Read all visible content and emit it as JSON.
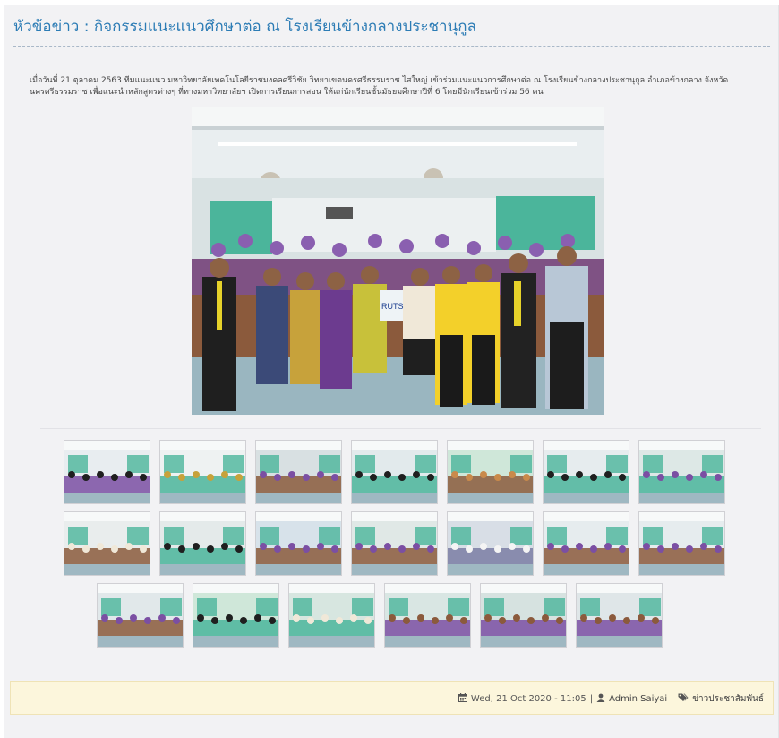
{
  "news": {
    "title": "หัวข้อข่าว : กิจกรรมแนะแนวศึกษาต่อ ณ โรงเรียนข้างกลางประชานุกูล",
    "body": "เมื่อวันที่ 21 ตุลาคม 2563 ทีมแนะแนว มหาวิทยาลัยเทคโนโลยีราชมงคลศรีวิชัย วิทยาเขตนครศรีธรรมราช ไสใหญ่ เข้าร่วมแนะแนวการศึกษาต่อ ณ โรงเรียนข้างกลางประชานุกูล อำเภอข้างกลาง จังหวัดนครศรีธรรมราช เพื่อแนะนำหลักสูตรต่างๆ ที่ทางมหาวิทยาลัยฯ เปิดการเรียนการสอน ให้แก่นักเรียนชั้นมัธยมศึกษาปีที่ 6 โดยมีนักเรียนเข้าร่วม 56 คน",
    "main_photo_bag_label": "RUTS"
  },
  "gallery": {
    "thumbnail_count": 20
  },
  "footer": {
    "date": "Wed, 21 Oct 2020 - 11:05",
    "separator": "|",
    "author": "Admin Saiyai",
    "category": "ข่าวประชาสัมพันธ์"
  },
  "icons": {
    "calendar": "calendar-icon",
    "user": "user-icon",
    "tags": "tags-icon"
  },
  "colors": {
    "title": "#2c7cb5",
    "footer_bg": "#fcf6dc",
    "panel_bg": "#f2f2f4"
  }
}
